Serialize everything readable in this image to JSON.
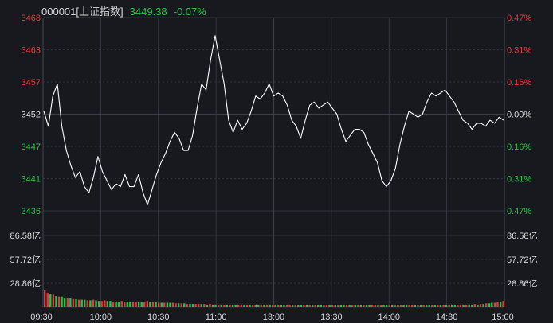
{
  "header": {
    "code": "000001",
    "name": "[上证指数]",
    "price": "3449.38",
    "change_pct": "-0.07%"
  },
  "colors": {
    "background": "#17191f",
    "grid": "#3a3d46",
    "up": "#e23b3b",
    "down": "#2fbf4a",
    "neutral": "#d8d8d8",
    "line": "#ffffff"
  },
  "chart_data": [
    {
      "type": "line",
      "title": "",
      "price_axis_labels": [
        "3468",
        "3463",
        "3457",
        "3452",
        "3447",
        "3441",
        "3436"
      ],
      "pct_axis_labels": [
        "0.47%",
        "0.31%",
        "0.16%",
        "0.00%",
        "0.16%",
        "0.31%",
        "0.47%"
      ],
      "ylim": [
        3436,
        3468
      ],
      "base_price": 3452,
      "x_labels": [
        "09:30",
        "10:00",
        "10:30",
        "11:00",
        "13:00",
        "13:30",
        "14:00",
        "14:30",
        "15:00"
      ],
      "series": [
        {
          "values": [
            3452.5,
            3450,
            3455,
            3457,
            3450,
            3446,
            3443.5,
            3441.5,
            3442.5,
            3440,
            3439,
            3441.5,
            3445,
            3442.5,
            3441,
            3439.5,
            3440.5,
            3440,
            3442,
            3440,
            3440,
            3442,
            3439,
            3437,
            3439.5,
            3442,
            3444,
            3445.5,
            3447.5,
            3449,
            3448,
            3446,
            3446,
            3448.5,
            3453,
            3457,
            3456,
            3461,
            3465,
            3461,
            3457,
            3451,
            3449,
            3451,
            3449.5,
            3450.5,
            3452.5,
            3455,
            3454.5,
            3455.5,
            3457,
            3455,
            3455.5,
            3455,
            3453.5,
            3451,
            3450,
            3448,
            3451,
            3453.5,
            3454,
            3453,
            3453.5,
            3454,
            3453,
            3452,
            3449.5,
            3447.5,
            3448.5,
            3449.5,
            3449.5,
            3449,
            3447,
            3445.5,
            3444,
            3441,
            3440,
            3441,
            3443,
            3447,
            3450,
            3452.5,
            3452,
            3451.5,
            3452,
            3454,
            3455.5,
            3455,
            3455.5,
            3456,
            3455,
            3454,
            3452.5,
            3451,
            3450.5,
            3449.5,
            3450.5,
            3450.5,
            3450,
            3451,
            3450.5,
            3451.5,
            3451
          ]
        }
      ]
    },
    {
      "type": "bar",
      "title": "",
      "y_labels": [
        "86.58亿",
        "57.72亿",
        "28.86亿"
      ],
      "ylim": [
        0,
        115.44
      ],
      "values": [
        27,
        23,
        21,
        20,
        18,
        17,
        17,
        15,
        14,
        14,
        13,
        13,
        12,
        12,
        12,
        11,
        11,
        12,
        11,
        10,
        10,
        11,
        10,
        10,
        9,
        9,
        9,
        10,
        9,
        9,
        8,
        8,
        9,
        8,
        8,
        8,
        10,
        9,
        8,
        8,
        7,
        7,
        7,
        7,
        7,
        7,
        6,
        6,
        6,
        6,
        5,
        5,
        5,
        5,
        5,
        5,
        5,
        4,
        5,
        4,
        4,
        4,
        4,
        4,
        4,
        4,
        4,
        4,
        4,
        4,
        4,
        4,
        4,
        4,
        4,
        4,
        4,
        4,
        4,
        4,
        3,
        4,
        3,
        3,
        3,
        3,
        4,
        3,
        3,
        3,
        3,
        3,
        3,
        3,
        3,
        3,
        3,
        3,
        3,
        3,
        3,
        3,
        3,
        3,
        3,
        3,
        3,
        3,
        3,
        3,
        3,
        3,
        3,
        3,
        3,
        3,
        3,
        3,
        3,
        3,
        3,
        4,
        3,
        3,
        3,
        3,
        3,
        4,
        3,
        3,
        3,
        3,
        3,
        3,
        3,
        3,
        3,
        3,
        3,
        3,
        3,
        3,
        4,
        4,
        4,
        4,
        4,
        4,
        4,
        4,
        4,
        5,
        4,
        5,
        5,
        6,
        6,
        7,
        7,
        8,
        9,
        10
      ],
      "directions": [
        "r",
        "r",
        "g",
        "r",
        "g",
        "r",
        "g",
        "g",
        "r",
        "g",
        "r",
        "g",
        "r",
        "g",
        "g",
        "r",
        "g",
        "r",
        "g",
        "g",
        "r",
        "r",
        "g",
        "g",
        "r",
        "g",
        "g",
        "r",
        "r",
        "g",
        "g",
        "r",
        "r",
        "g",
        "g",
        "r",
        "r",
        "g",
        "r",
        "g",
        "r",
        "g",
        "r",
        "g",
        "g",
        "r",
        "r",
        "g",
        "r",
        "g",
        "r",
        "g",
        "g",
        "r",
        "r",
        "g",
        "r",
        "g",
        "r",
        "g",
        "g",
        "r",
        "g",
        "r",
        "g",
        "r",
        "g",
        "g",
        "r",
        "r",
        "g",
        "r",
        "g",
        "r",
        "g",
        "g",
        "r",
        "g",
        "r",
        "g",
        "r",
        "g",
        "r",
        "g",
        "g",
        "r",
        "r",
        "g",
        "r",
        "g",
        "g",
        "r",
        "g",
        "r",
        "g",
        "r",
        "g",
        "g",
        "r",
        "r",
        "g",
        "r",
        "g",
        "r",
        "g",
        "g",
        "r",
        "g",
        "r",
        "g",
        "r",
        "g",
        "r",
        "g",
        "g",
        "r",
        "r",
        "g",
        "r",
        "g",
        "g",
        "r",
        "g",
        "r",
        "g",
        "r",
        "g",
        "g",
        "r",
        "r",
        "g",
        "r",
        "g",
        "r",
        "g",
        "g",
        "r",
        "g",
        "r",
        "g",
        "r",
        "g",
        "r",
        "g",
        "g",
        "r",
        "r",
        "g",
        "r",
        "g",
        "g",
        "r",
        "g",
        "r",
        "g",
        "r",
        "g",
        "g",
        "r",
        "r",
        "g",
        "r"
      ]
    }
  ]
}
